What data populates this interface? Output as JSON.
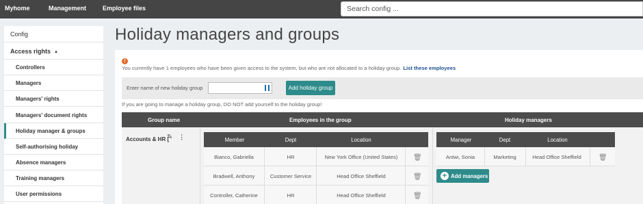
{
  "topnav": {
    "items": [
      "Myhome",
      "Management",
      "Employee files"
    ],
    "search_placeholder": "Search config ..."
  },
  "sidebar": {
    "config": "Config",
    "section": "Access rights",
    "section_caret": "▲",
    "items": [
      "Controllers",
      "Managers",
      "Managers' rights",
      "Managers' document rights",
      "Holiday manager & groups",
      "Self-authorising holiday",
      "Absence managers",
      "Training managers",
      "User permissions"
    ],
    "active_item": "Holiday manager & groups"
  },
  "page": {
    "title": "Holiday managers and groups",
    "info_icon": "!",
    "info_text": "You currently have 1 employees who have been given access to the system, but who are not allocated to a holiday group.",
    "info_link": "List these employees",
    "add_group_label": "Enter name of new holiday group",
    "add_group_value": "",
    "add_group_button": "Add holiday group",
    "warning": "If you are going to manage a holiday group, DO NOT add yourself to the holiday group!"
  },
  "groups_table": {
    "headers": [
      "Group name",
      "Employees in the group",
      "Holiday managers"
    ],
    "groups": [
      {
        "name": "Accounts & HR [",
        "icons": [
          "edit-icon",
          "more-icon"
        ],
        "employees_headers": [
          "Member",
          "Dept",
          "Location"
        ],
        "employees": [
          {
            "member": "Bianco, Gabriella",
            "dept": "HR",
            "location": "New York Office (United States)"
          },
          {
            "member": "Bradwell, Anthony",
            "dept": "Customer Service",
            "location": "Head Office Sheffield"
          },
          {
            "member": "Controller, Catherine",
            "dept": "HR",
            "location": "Head Office Sheffield"
          }
        ],
        "managers_headers": [
          "Manager",
          "Dept",
          "Location"
        ],
        "managers": [
          {
            "manager": "Antwi, Sonia",
            "dept": "Marketing",
            "location": "Head Office Sheffield"
          }
        ],
        "add_managers_button": "Add managers"
      }
    ]
  },
  "colors": {
    "topbar": "#454545",
    "accent": "#2e8b8b",
    "header_dark": "#4c4c4c",
    "info_orange": "#e06a2c",
    "link_blue": "#1d4f91"
  }
}
